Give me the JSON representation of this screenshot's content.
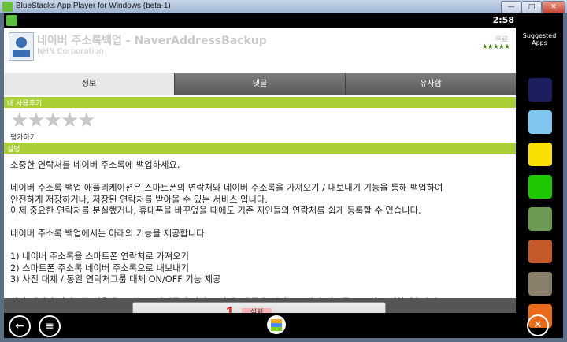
{
  "window": {
    "title": "BlueStacks App Player for Windows (beta-1)",
    "minimize": "—",
    "maximize": "□",
    "close": "✕"
  },
  "status": {
    "time": "2:58"
  },
  "app": {
    "name": "네이버 주소록백업 - NaverAddressBackup",
    "developer": "NHN Corporation",
    "price": "무료",
    "mini_stars": "★★★★★"
  },
  "tabs": [
    "정보",
    "댓글",
    "유사함"
  ],
  "review_section": {
    "title": "내 사용후기",
    "rate_label": "평가하기"
  },
  "description_section": {
    "title": "설명",
    "lines": [
      "소중한 연락처를 네이버 주소록에 백업하세요.",
      "",
      "네이버 주소록 백업 애플리케이션은 스마트폰의 연락처와 네이버 주소록을 가져오기 / 내보내기 기능을 통해 백업하여",
      "안전하게 저장하거나, 저장된 연락처를 받아올 수 있는 서비스 입니다.",
      "이제 중요한 연락처를 분실했거나, 휴대폰을 바꾸었을 때에도 기존 지인들의 연락처를 쉽게 등록할 수 있습니다.",
      "",
      "네이버 주소록 백업에서는 아래의 기능을 제공합니다.",
      "",
      "1) 네이버 주소록을 스마트폰 연락처로 가져오기",
      "2) 스마트폰 주소록 네이버 주소록으로 내보내기",
      "3) 사진 대체 / 동일 연락처그룹 대체 ON/OFF 기능 제공",
      "",
      "항상 네이버 서비스를 이용해 주시는 고객님들께 감사 드리며, 더 좋은 서비스로 찾아 뵙도록 꾸준히 노력하겠습니다."
    ]
  },
  "install": {
    "label": "설치",
    "annotation": "1."
  },
  "sidebar": {
    "title": "Suggested Apps",
    "apps": [
      {
        "name": "angry-birds-space",
        "color": "#1b1f5e"
      },
      {
        "name": "angry-birds",
        "color": "#7fc6ef"
      },
      {
        "name": "kakao-talk",
        "color": "#f9e000"
      },
      {
        "name": "naver",
        "color": "#1ec800"
      },
      {
        "name": "app-5",
        "color": "#6c9a55"
      },
      {
        "name": "app-6",
        "color": "#c45a2a"
      },
      {
        "name": "app-7",
        "color": "#8a7f6a"
      },
      {
        "name": "app-8",
        "color": "#e86a1a"
      }
    ]
  }
}
